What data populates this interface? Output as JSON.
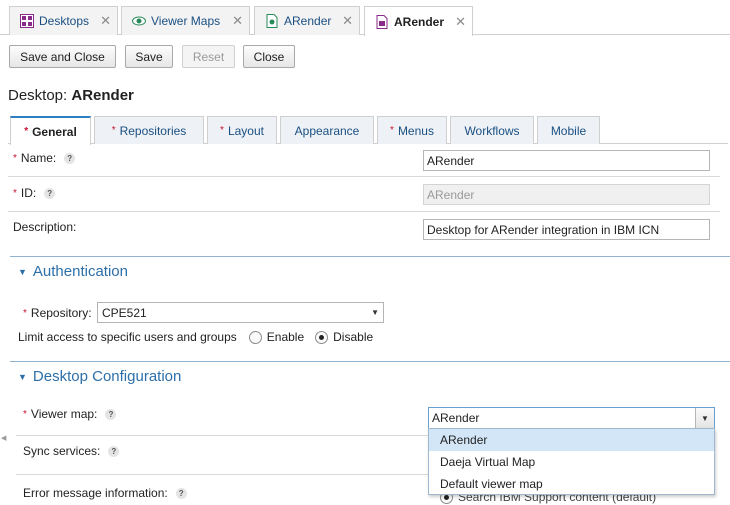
{
  "doc_tabs": [
    {
      "label": "Desktops",
      "icon": "desktops-grid-icon"
    },
    {
      "label": "Viewer Maps",
      "icon": "eye-icon"
    },
    {
      "label": "ARender",
      "icon": "document-icon"
    },
    {
      "label": "ARender",
      "icon": "document-icon",
      "active": true
    }
  ],
  "toolbar": {
    "save_close": "Save and Close",
    "save": "Save",
    "reset": "Reset",
    "close": "Close"
  },
  "page_title": {
    "prefix": "Desktop:",
    "name": "ARender"
  },
  "sub_tabs": [
    {
      "label": "General",
      "required": true,
      "active": true
    },
    {
      "label": "Repositories",
      "required": true
    },
    {
      "label": "Layout",
      "required": true
    },
    {
      "label": "Appearance"
    },
    {
      "label": "Menus",
      "required": true
    },
    {
      "label": "Workflows"
    },
    {
      "label": "Mobile"
    }
  ],
  "general": {
    "name_label": "Name:",
    "name_value": "ARender",
    "id_label": "ID:",
    "id_value": "ARender",
    "description_label": "Description:",
    "description_value": "Desktop for ARender integration in IBM ICN"
  },
  "authentication": {
    "title": "Authentication",
    "repository_label": "Repository:",
    "repository_value": "CPE521",
    "limit_label": "Limit access to specific users and groups",
    "enable_label": "Enable",
    "disable_label": "Disable",
    "selected": "disable"
  },
  "desktop_config": {
    "title": "Desktop Configuration",
    "viewer_map_label": "Viewer map:",
    "viewer_map_value": "ARender",
    "viewer_map_options": [
      "ARender",
      "Daeja Virtual Map",
      "Default viewer map"
    ],
    "sync_label": "Sync services:",
    "error_label": "Error message information:",
    "error_option_partial": "Search IBM Support content (default)"
  },
  "help_glyph": "?",
  "required_glyph": "*",
  "colors": {
    "link": "#1a4f82",
    "section": "#2c6fa8",
    "required": "#c8102e",
    "selected_option": "#d3e6f7"
  }
}
